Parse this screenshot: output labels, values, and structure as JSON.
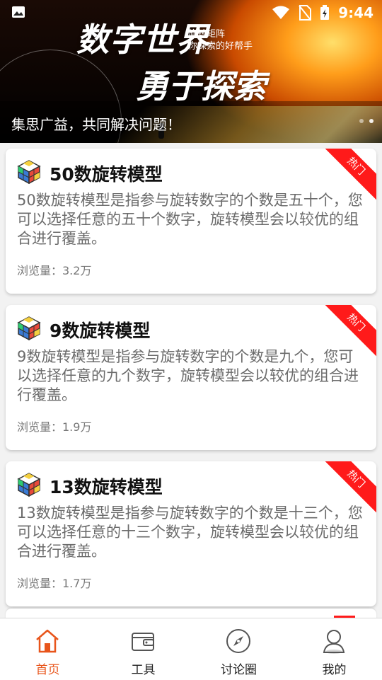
{
  "status_bar": {
    "time": "9:44"
  },
  "banner": {
    "headline": "数字世界",
    "tagline_line1": "旋转矩阵",
    "tagline_line2": "你探索的好帮手",
    "slogan": "勇于探索",
    "caption": "集思广益，共同解决问题！",
    "dots": 2,
    "active_dot": 1
  },
  "cards": [
    {
      "title": "50数旋转模型",
      "description": "50数旋转模型是指参与旋转数字的个数是五十个，您可以选择任意的五十个数字，旋转模型会以较优的组合进行覆盖。",
      "views": "浏览量：3.2万",
      "badge": "热门",
      "icon": "rubiks-cube-icon"
    },
    {
      "title": "9数旋转模型",
      "description": "9数旋转模型是指参与旋转数字的个数是九个，您可以选择任意的九个数字，旋转模型会以较优的组合进行覆盖。",
      "views": "浏览量：1.9万",
      "badge": "热门",
      "icon": "rubiks-cube-icon"
    },
    {
      "title": "13数旋转模型",
      "description": "13数旋转模型是指参与旋转数字的个数是十三个，您可以选择任意的十三个数字，旋转模型会以较优的组合进行覆盖。",
      "views": "浏览量：1.7万",
      "badge": "热门",
      "icon": "rubiks-cube-icon"
    }
  ],
  "bottom_nav": [
    {
      "label": "首页",
      "icon": "home-icon",
      "active": true
    },
    {
      "label": "工具",
      "icon": "wallet-icon",
      "active": false
    },
    {
      "label": "讨论圈",
      "icon": "compass-icon",
      "active": false
    },
    {
      "label": "我的",
      "icon": "user-icon",
      "active": false
    }
  ],
  "colors": {
    "accent": "#e8551b",
    "hot_badge": "#ff1a1a",
    "card_bg": "#ffffff",
    "page_bg": "#f2f2f2"
  }
}
